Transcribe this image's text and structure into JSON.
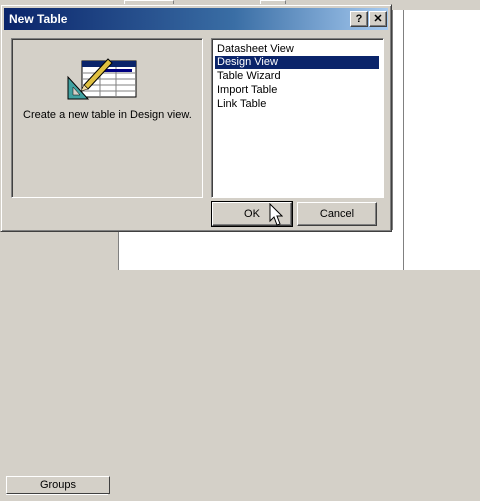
{
  "background": {
    "groups_label": "Groups"
  },
  "dialog": {
    "title": "New Table",
    "help_icon_glyph": "?",
    "close_icon_glyph": "✕",
    "preview_description": "Create a new table in Design view.",
    "options": [
      {
        "label": "Datasheet View",
        "selected": false
      },
      {
        "label": "Design View",
        "selected": true
      },
      {
        "label": "Table Wizard",
        "selected": false
      },
      {
        "label": "Import Table",
        "selected": false
      },
      {
        "label": "Link Table",
        "selected": false
      }
    ],
    "ok_label": "OK",
    "cancel_label": "Cancel"
  },
  "colors": {
    "title_bar": "#0a246a",
    "selection": "#0a246a",
    "face": "#d4d0c8"
  }
}
